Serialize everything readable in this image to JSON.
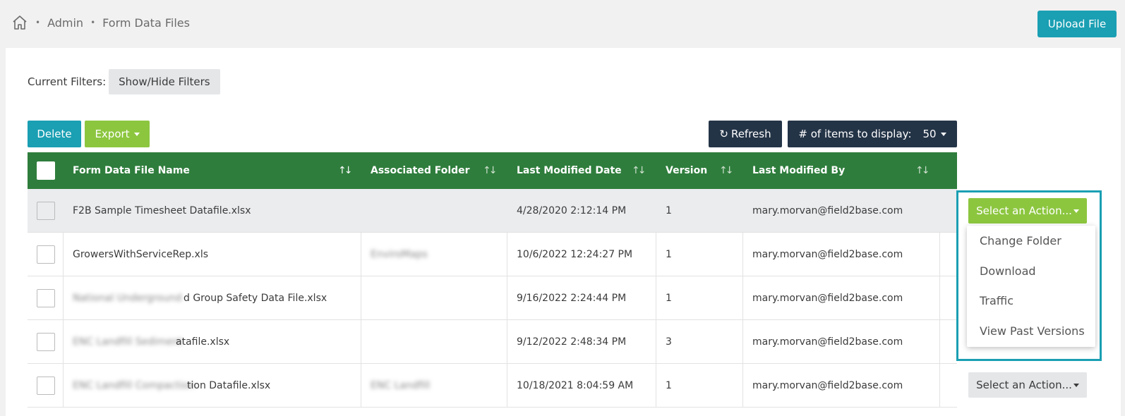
{
  "breadcrumb": {
    "items": [
      "Admin",
      "Form Data Files"
    ]
  },
  "header": {
    "upload_label": "Upload File"
  },
  "filters": {
    "label": "Current Filters:",
    "toggle_label": "Show/Hide Filters"
  },
  "toolbar": {
    "delete_label": "Delete",
    "export_label": "Export",
    "refresh_label": "Refresh",
    "items_label": "# of items to display:",
    "items_value": "50"
  },
  "table": {
    "columns": [
      "Form Data File Name",
      "Associated Folder",
      "Last Modified Date",
      "Version",
      "Last Modified By"
    ],
    "rows": [
      {
        "name": "F2B Sample Timesheet Datafile.xlsx",
        "folder": "",
        "date": "4/28/2020 2:12:14 PM",
        "version": "1",
        "by": "mary.morvan@field2base.com"
      },
      {
        "name": "GrowersWithServiceRep.xls",
        "folder": "EnviroMaps",
        "date": "10/6/2022 12:24:27 PM",
        "version": "1",
        "by": "mary.morvan@field2base.com"
      },
      {
        "name_blur": "National Underground",
        "name": "d Group Safety Data File.xlsx",
        "folder": "",
        "date": "9/16/2022 2:24:44 PM",
        "version": "1",
        "by": "mary.morvan@field2base.com"
      },
      {
        "name_blur": "ENC Landfill Sediment",
        "name": "atafile.xlsx",
        "folder": "",
        "date": "9/12/2022 2:48:34 PM",
        "version": "3",
        "by": "mary.morvan@field2base.com"
      },
      {
        "name_blur": "ENC Landfill Compaction",
        "name": "tion Datafile.xlsx",
        "folder": "ENC Landfill",
        "date": "10/18/2021 8:04:59 AM",
        "version": "1",
        "by": "mary.morvan@field2base.com"
      }
    ]
  },
  "actions": {
    "label": "Select an Action...",
    "menu": [
      "Change Folder",
      "Download",
      "Traffic",
      "View Past Versions"
    ]
  },
  "colors": {
    "teal": "#1a9fb3",
    "green": "#8cc63f",
    "header_green": "#2e7d3c",
    "navy": "#243447"
  },
  "icons": [
    "home-icon",
    "refresh-icon",
    "sort-icon",
    "caret-down-icon"
  ]
}
